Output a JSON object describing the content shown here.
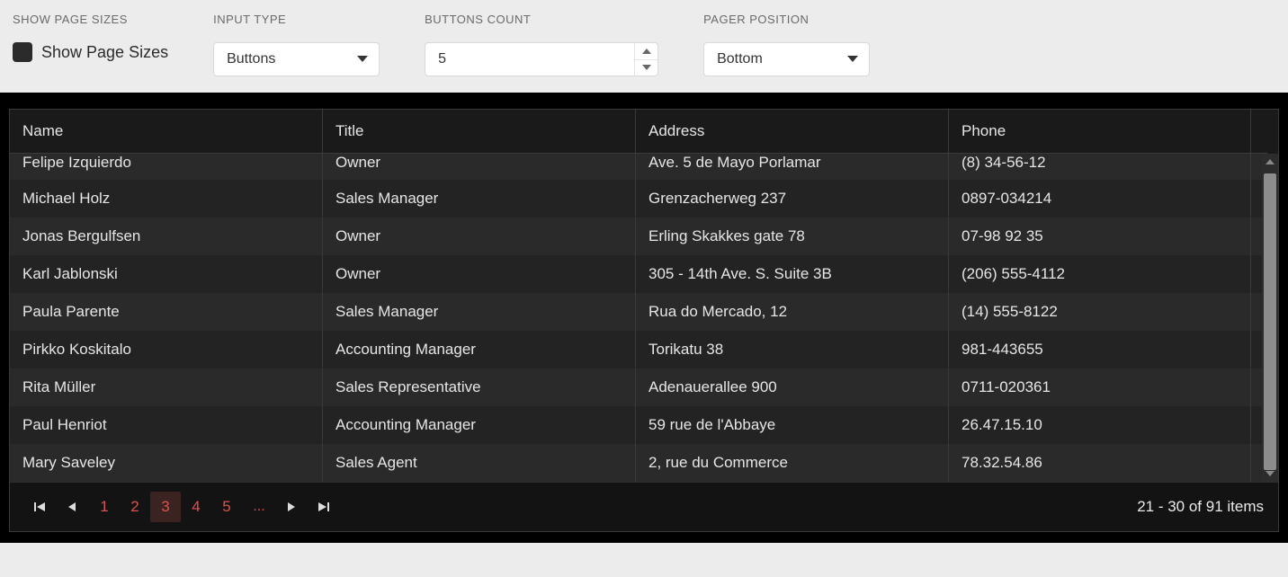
{
  "controls": {
    "show_page_sizes": {
      "label": "SHOW PAGE SIZES",
      "checkbox_label": "Show Page Sizes",
      "checked": false
    },
    "input_type": {
      "label": "INPUT TYPE",
      "value": "Buttons"
    },
    "buttons_count": {
      "label": "BUTTONS COUNT",
      "value": "5"
    },
    "pager_position": {
      "label": "PAGER POSITION",
      "value": "Bottom"
    }
  },
  "grid": {
    "columns": [
      "Name",
      "Title",
      "Address",
      "Phone"
    ],
    "rows": [
      {
        "name": "Felipe Izquierdo",
        "title": "Owner",
        "address": "Ave. 5 de Mayo Porlamar",
        "phone": "(8) 34-56-12"
      },
      {
        "name": "Michael Holz",
        "title": "Sales Manager",
        "address": "Grenzacherweg 237",
        "phone": "0897-034214"
      },
      {
        "name": "Jonas Bergulfsen",
        "title": "Owner",
        "address": "Erling Skakkes gate 78",
        "phone": "07-98 92 35"
      },
      {
        "name": "Karl Jablonski",
        "title": "Owner",
        "address": "305 - 14th Ave. S. Suite 3B",
        "phone": "(206) 555-4112"
      },
      {
        "name": "Paula Parente",
        "title": "Sales Manager",
        "address": "Rua do Mercado, 12",
        "phone": "(14) 555-8122"
      },
      {
        "name": "Pirkko Koskitalo",
        "title": "Accounting Manager",
        "address": "Torikatu 38",
        "phone": "981-443655"
      },
      {
        "name": "Rita Müller",
        "title": "Sales Representative",
        "address": "Adenauerallee 900",
        "phone": "0711-020361"
      },
      {
        "name": "Paul Henriot",
        "title": "Accounting Manager",
        "address": "59 rue de l'Abbaye",
        "phone": "26.47.15.10"
      },
      {
        "name": "Mary Saveley",
        "title": "Sales Agent",
        "address": "2, rue du Commerce",
        "phone": "78.32.54.86"
      }
    ]
  },
  "pager": {
    "pages": [
      "1",
      "2",
      "3",
      "4",
      "5"
    ],
    "active": "3",
    "ellipsis": "...",
    "info": "21 - 30 of 91 items"
  }
}
